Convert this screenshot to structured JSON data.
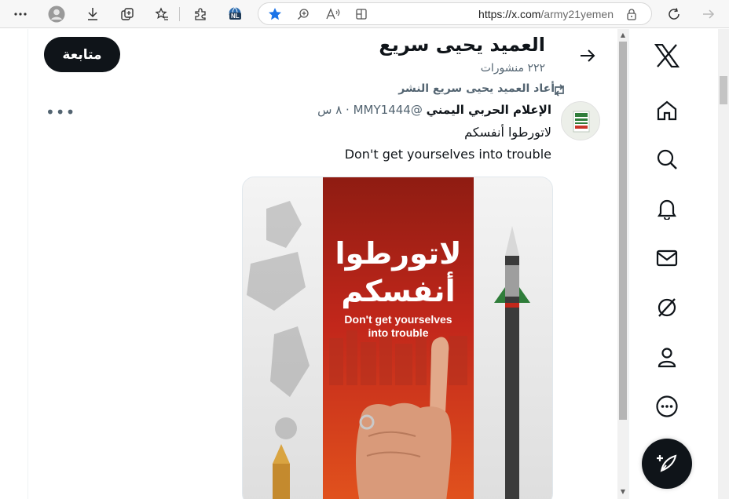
{
  "browser": {
    "url_host": "https://x.com",
    "url_path": "/army21yemen",
    "nl_badge": "NL"
  },
  "profile": {
    "name": "العميد يحيى سريع",
    "post_count": "٢٢٢ منشورات",
    "follow_label": "متابعة"
  },
  "tweet": {
    "repost_label": "أعاد العميد يحيى سريع النشر",
    "author": "الإعلام الحربي اليمني",
    "handle": "@MMY1444",
    "dot": "·",
    "time": "٨ س",
    "text_ar": "لاتورطوا أنفسكم",
    "text_en": "Don't get yourselves into trouble",
    "more": "•••"
  },
  "media": {
    "headline_line1": "لاتورطوا",
    "headline_line2": "أنفسكم",
    "subtitle_line1": "Don't get yourselves",
    "subtitle_line2": "into trouble"
  },
  "colors": {
    "accent_black": "#0f1419",
    "muted_text": "#536471",
    "star_blue": "#1a73e8",
    "poster_red": "#c2271b"
  },
  "icons": {
    "browser": [
      "more-icon",
      "profile-icon",
      "download-icon",
      "collections-icon",
      "favorites-icon",
      "extensions-icon",
      "translate-icon",
      "star-icon",
      "zoom-icon",
      "read-aloud-icon",
      "split-screen-icon",
      "lock-icon",
      "refresh-icon",
      "forward-icon"
    ],
    "nav": [
      "x-logo-icon",
      "home-icon",
      "search-icon",
      "notifications-icon",
      "messages-icon",
      "grok-icon",
      "profile-icon",
      "more-icon",
      "compose-icon"
    ]
  }
}
